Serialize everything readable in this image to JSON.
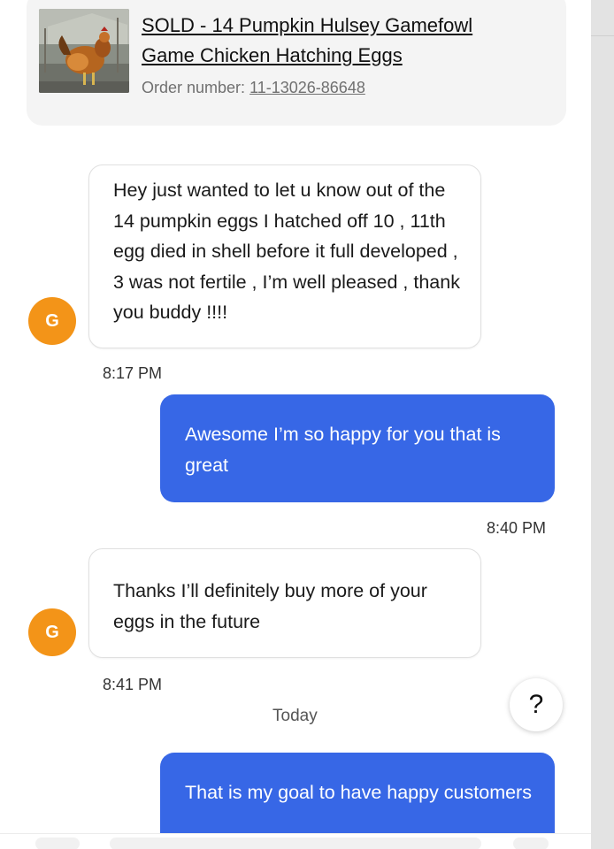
{
  "listing": {
    "title": "SOLD - 14 Pumpkin Hulsey Gamefowl Game Chicken Hatching Eggs",
    "order_label": "Order number:",
    "order_number": "11-13026-86648"
  },
  "messages": [
    {
      "from": "buyer",
      "avatar_letter": "G",
      "text": "Hey just wanted to let u know out of the 14 pumpkin eggs I hatched off 10 , 11th egg died in shell before it full developed , 3 was not fertile , I’m well pleased , thank you buddy !!!!",
      "time": "8:17 PM"
    },
    {
      "from": "seller",
      "text": "Awesome I’m so happy for you that is great",
      "time": "8:40 PM"
    },
    {
      "from": "buyer",
      "avatar_letter": "G",
      "text": "Thanks I’ll definitely buy more of your eggs in the future",
      "time": "8:41 PM"
    },
    {
      "from": "seller",
      "text": "That is my goal to have happy customers"
    }
  ],
  "divider_today": "Today",
  "help": {
    "label": "?"
  },
  "colors": {
    "avatar": "#f39418",
    "outgoing_bubble": "#3767e6",
    "incoming_bubble": "#ffffff"
  },
  "icons": {
    "help": "question-mark-icon"
  }
}
